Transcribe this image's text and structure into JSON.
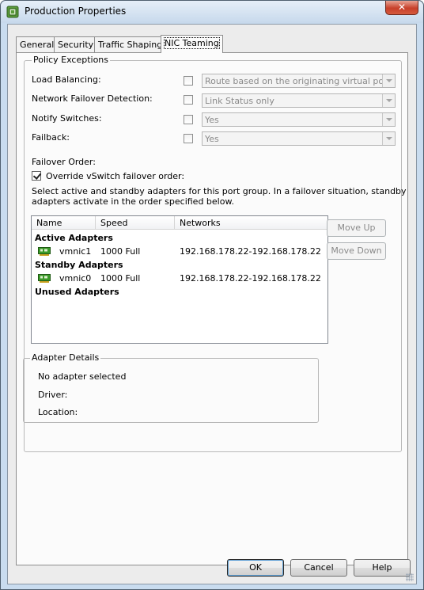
{
  "window": {
    "title": "Production Properties",
    "close_glyph": "✕"
  },
  "tabs": [
    {
      "label": "General",
      "active": false
    },
    {
      "label": "Security",
      "active": false
    },
    {
      "label": "Traffic Shaping",
      "active": false
    },
    {
      "label": "NIC Teaming",
      "active": true
    }
  ],
  "policy": {
    "legend": "Policy Exceptions",
    "rows": [
      {
        "label": "Load Balancing:",
        "checked": false,
        "value": "Route based on the originating virtual port ID"
      },
      {
        "label": "Network Failover Detection:",
        "checked": false,
        "value": "Link Status only"
      },
      {
        "label": "Notify Switches:",
        "checked": false,
        "value": "Yes"
      },
      {
        "label": "Failback:",
        "checked": false,
        "value": "Yes"
      }
    ]
  },
  "failover": {
    "heading": "Failover Order:",
    "override_label": "Override vSwitch failover order:",
    "override_checked": true,
    "description_line1": "Select active and standby adapters for this port group.  In a failover situation, standby",
    "description_line2": "adapters activate  in the order specified below."
  },
  "adapter_list": {
    "columns": [
      "Name",
      "Speed",
      "Networks"
    ],
    "sections": {
      "active": "Active Adapters",
      "standby": "Standby Adapters",
      "unused": "Unused Adapters"
    },
    "rows": [
      {
        "name": "vmnic1",
        "speed": "1000 Full",
        "networks": "192.168.178.22-192.168.178.22",
        "icon": "nic-icon"
      },
      {
        "name": "vmnic0",
        "speed": "1000 Full",
        "networks": "192.168.178.22-192.168.178.22",
        "icon": "nic-icon"
      }
    ]
  },
  "move_buttons": {
    "up": "Move Up",
    "down": "Move Down"
  },
  "adapter_details": {
    "legend": "Adapter Details",
    "selection": "No adapter selected",
    "driver_label": "Driver:",
    "location_label": "Location:"
  },
  "footer": {
    "ok": "OK",
    "cancel": "Cancel",
    "help": "Help"
  },
  "colors": {
    "nic_green": "#3b9a2a",
    "title_bar": "#c7d9ec",
    "close_red": "#c7402a"
  }
}
